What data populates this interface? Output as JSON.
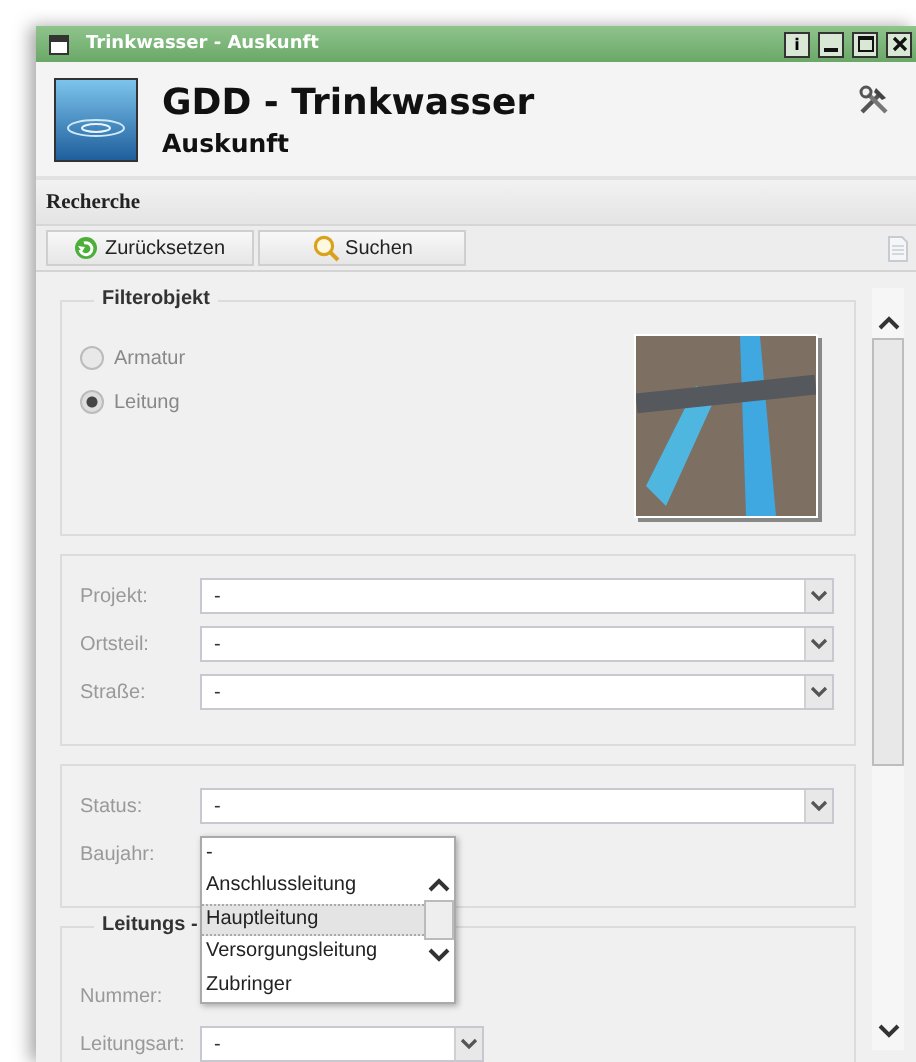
{
  "window": {
    "title": "Trinkwasser - Auskunft",
    "buttons": [
      {
        "kind": "info",
        "label": "i"
      },
      {
        "kind": "minimize"
      },
      {
        "kind": "maximize"
      },
      {
        "kind": "close"
      }
    ]
  },
  "header": {
    "title": "GDD - Trinkwasser",
    "subtitle": "Auskunft"
  },
  "section_title": "Recherche",
  "toolbar": {
    "buttons": [
      {
        "kind": "reset",
        "label": "Zurücksetzen"
      },
      {
        "kind": "search",
        "label": "Suchen"
      }
    ]
  },
  "filter_object": {
    "legend": "Filterobjekt",
    "options": [
      {
        "label": "Armatur",
        "selected": false
      },
      {
        "label": "Leitung",
        "selected": true
      }
    ]
  },
  "location_fields": [
    {
      "label": "Projekt:",
      "value": "-"
    },
    {
      "label": "Ortsteil:",
      "value": "-"
    },
    {
      "label": "Straße:",
      "value": "-"
    }
  ],
  "status_fields": {
    "status": {
      "label": "Status:",
      "value": "-"
    },
    "baujahr": {
      "label": "Baujahr:"
    }
  },
  "leitung_group": {
    "legend": "Leitungs -",
    "nummer": {
      "label": "Nummer:"
    },
    "leitungsart": {
      "label": "Leitungsart:",
      "value": "-"
    }
  },
  "dropdown": {
    "options": [
      {
        "label": "-",
        "selected": false
      },
      {
        "label": "Anschlussleitung",
        "selected": false
      },
      {
        "label": "Hauptleitung",
        "selected": true
      },
      {
        "label": "Versorgungsleitung",
        "selected": false
      },
      {
        "label": "Zubringer",
        "selected": false
      }
    ]
  }
}
